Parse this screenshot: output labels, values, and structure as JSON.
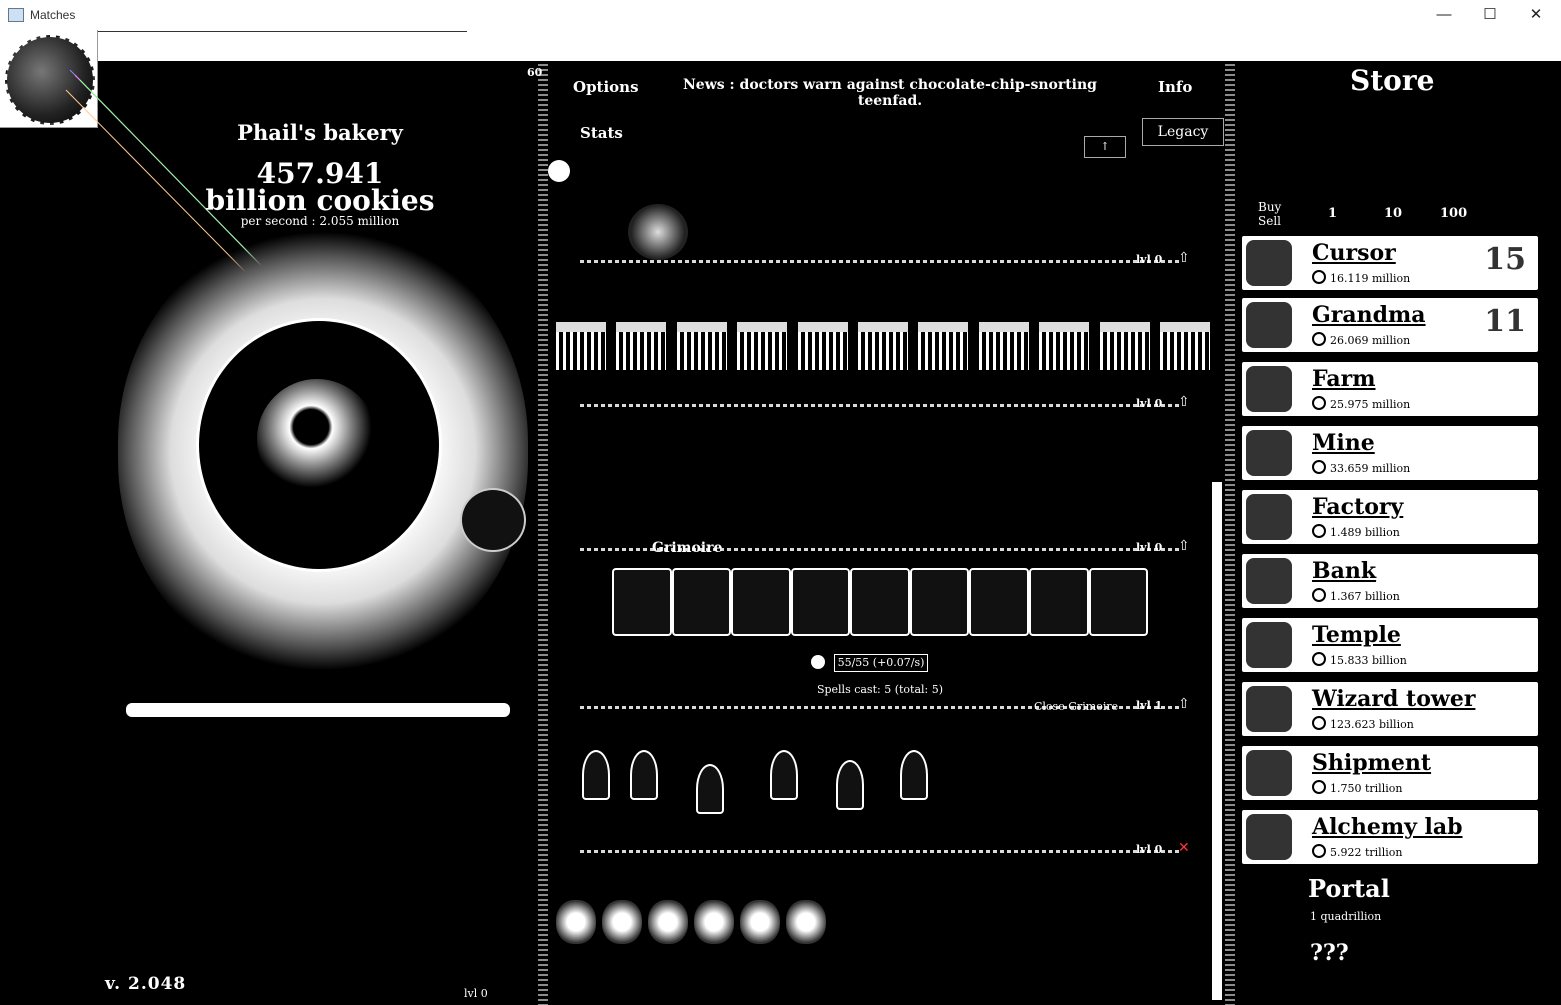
{
  "window": {
    "title": "Matches"
  },
  "bakery": {
    "name": "Phail's bakery",
    "cookies_line1": "457.941",
    "cookies_line2": "billion cookies",
    "per_second": "per second : 2.055 million",
    "version": "v. 2.048"
  },
  "menu": {
    "options": "Options",
    "stats": "Stats",
    "info": "Info",
    "legacy": "Legacy",
    "fps": "60"
  },
  "news": "News : doctors warn against chocolate-chip-snorting teenfad.",
  "buildings": {
    "level_labels": [
      "lvl 0",
      "lvl 0",
      "lvl 0",
      "lvl 1",
      "lvl 0"
    ],
    "left_level": "lvl 0"
  },
  "grimoire": {
    "title": "Grimoire",
    "magic": "55/55 (+0.07/s)",
    "spells_cast": "Spells cast: 5 (total: 5)",
    "close": "Close Grimoire"
  },
  "store": {
    "title": "Store",
    "buy": "Buy",
    "sell": "Sell",
    "bulk": [
      "1",
      "10",
      "100"
    ],
    "products": [
      {
        "name": "Cursor",
        "price": "16.119 million",
        "owned": "15"
      },
      {
        "name": "Grandma",
        "price": "26.069 million",
        "owned": "11"
      },
      {
        "name": "Farm",
        "price": "25.975 million",
        "owned": ""
      },
      {
        "name": "Mine",
        "price": "33.659 million",
        "owned": ""
      },
      {
        "name": "Factory",
        "price": "1.489 billion",
        "owned": ""
      },
      {
        "name": "Bank",
        "price": "1.367 billion",
        "owned": ""
      },
      {
        "name": "Temple",
        "price": "15.833 billion",
        "owned": ""
      },
      {
        "name": "Wizard tower",
        "price": "123.623 billion",
        "owned": ""
      },
      {
        "name": "Shipment",
        "price": "1.750 trillion",
        "owned": ""
      },
      {
        "name": "Alchemy lab",
        "price": "5.922 trillion",
        "owned": ""
      }
    ],
    "portal": {
      "name": "Portal",
      "price": "1 quadrillion"
    },
    "mystery": "???"
  }
}
